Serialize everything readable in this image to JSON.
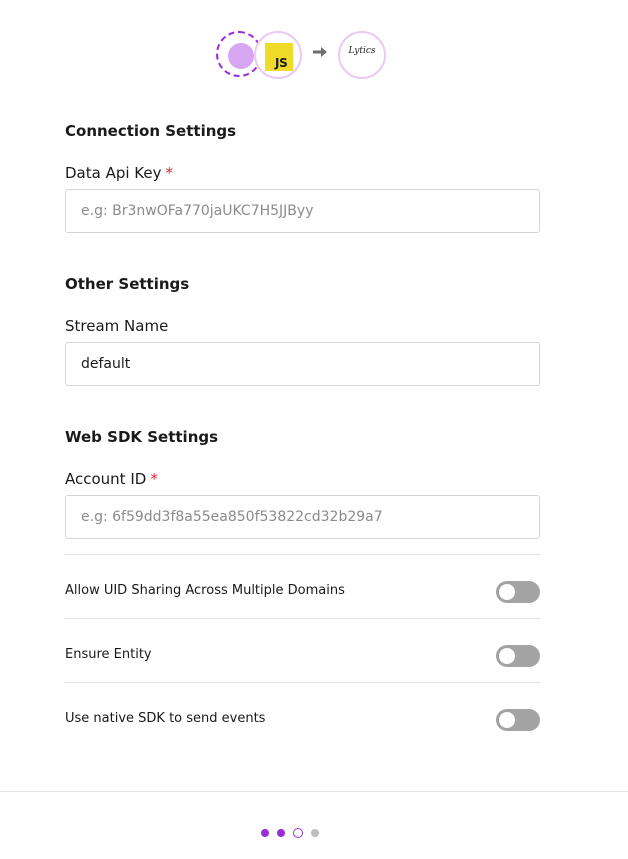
{
  "header": {
    "source_icon": "dashed-source-circle",
    "js_label": "JS",
    "arrow_icon": "arrow-right-icon",
    "destination_logo": "Lytics"
  },
  "connection": {
    "title": "Connection Settings",
    "api_key_label": "Data Api Key",
    "required_mark": "*",
    "api_key_placeholder": "e.g: Br3nwOFa770jaUKC7H5JJByy",
    "api_key_value": ""
  },
  "other": {
    "title": "Other Settings",
    "stream_name_label": "Stream Name",
    "stream_name_value": "default"
  },
  "web_sdk": {
    "title": "Web SDK Settings",
    "account_id_label": "Account ID",
    "required_mark": "*",
    "account_id_placeholder": "e.g: 6f59dd3f8a55ea850f53822cd32b29a7",
    "account_id_value": "",
    "toggles": [
      {
        "label": "Allow UID Sharing Across Multiple Domains",
        "on": false
      },
      {
        "label": "Ensure Entity",
        "on": false
      },
      {
        "label": "Use native SDK to send events",
        "on": false
      }
    ]
  },
  "stepper": {
    "total_steps": 4,
    "current_step": 3
  },
  "colors": {
    "accent": "#9b2fd6",
    "required": "#e0272f",
    "toggle_off": "#a3a3a3",
    "js_yellow": "#f0db2a"
  }
}
